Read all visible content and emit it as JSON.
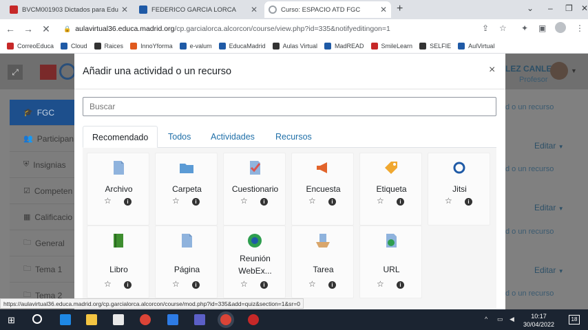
{
  "browser": {
    "tabs": [
      {
        "title": "BVCM001903 Dictados para Edu",
        "favicon_color": "#c62828"
      },
      {
        "title": "FEDERICO GARCIA LORCA",
        "favicon_color": "#1f5aa6"
      },
      {
        "title": "Curso: ESPACIO ATD FGC",
        "favicon_color": "#9aa0a6"
      }
    ],
    "new_tab": "+",
    "url_host": "aulavirtual36.educa.madrid.org",
    "url_path": "/cp.garcialorca.alcorcon/course/view.php?id=335&notifyeditingon=1",
    "bookmarks": [
      {
        "label": "CorreoEduca",
        "color": "#c62828"
      },
      {
        "label": "Cloud",
        "color": "#1f5aa6"
      },
      {
        "label": "Raices",
        "color": "#333333"
      },
      {
        "label": "InnoYforma",
        "color": "#e05a1e"
      },
      {
        "label": "e-valum",
        "color": "#1f5aa6"
      },
      {
        "label": "EducaMadrid",
        "color": "#1f5aa6"
      },
      {
        "label": "Aulas Virtual",
        "color": "#333333"
      },
      {
        "label": "MadREAD",
        "color": "#1f5aa6"
      },
      {
        "label": "SmileLearn",
        "color": "#c62828"
      },
      {
        "label": "SELFIE",
        "color": "#333333"
      },
      {
        "label": "AulVirtual",
        "color": "#1f5aa6"
      }
    ]
  },
  "moodle": {
    "user_name": "LEZ CANLE",
    "user_role": "Profesor",
    "nav": [
      {
        "label": "FGC",
        "icon": "graduation-cap-icon",
        "glyph": "🎓"
      },
      {
        "label": "Participan",
        "icon": "users-icon",
        "glyph": "👥"
      },
      {
        "label": "Insignias",
        "icon": "shield-icon",
        "glyph": "⛨"
      },
      {
        "label": "Competen",
        "icon": "check-square-icon",
        "glyph": "☑"
      },
      {
        "label": "Calificacio",
        "icon": "table-icon",
        "glyph": "▦"
      },
      {
        "label": "General",
        "icon": "folder-icon",
        "glyph": "🗀"
      },
      {
        "label": "Tema 1",
        "icon": "folder-icon",
        "glyph": "🗀"
      },
      {
        "label": "Tema 2",
        "icon": "folder-icon",
        "glyph": "🗀"
      }
    ],
    "right_links": {
      "add_resource": "d o un recurso",
      "edit": "Editar"
    }
  },
  "modal": {
    "title": "Añadir una actividad o un recurso",
    "close": "×",
    "search_placeholder": "Buscar",
    "tabs": [
      "Recomendado",
      "Todos",
      "Actividades",
      "Recursos"
    ],
    "activities": [
      {
        "name": "Archivo",
        "icon": "file-icon",
        "color": "#8fb3dd"
      },
      {
        "name": "Carpeta",
        "icon": "folder-icon",
        "color": "#5b9bd5"
      },
      {
        "name": "Cuestionario",
        "icon": "quiz-icon",
        "color": "#d9534f"
      },
      {
        "name": "Encuesta",
        "icon": "megaphone-icon",
        "color": "#e2642b"
      },
      {
        "name": "Etiqueta",
        "icon": "label-tag-icon",
        "color": "#f0a830"
      },
      {
        "name": "Jitsi",
        "icon": "jitsi-icon",
        "color": "#1f5aa6"
      },
      {
        "name": "Libro",
        "icon": "book-icon",
        "color": "#3e8e2f"
      },
      {
        "name": "Página",
        "icon": "page-icon",
        "color": "#8fb3dd"
      },
      {
        "name": "Reunión WebEx...",
        "line1": "Reunión",
        "line2": "WebEx...",
        "icon": "webex-icon",
        "color": "#2e9e4f"
      },
      {
        "name": "Tarea",
        "icon": "assignment-icon",
        "color": "#8fb3dd"
      },
      {
        "name": "URL",
        "icon": "url-globe-icon",
        "color": "#8fb3dd"
      }
    ],
    "star": "☆",
    "info": "i"
  },
  "status_url": "https://aulavirtual36.educa.madrid.org/cp.garcialorca.alcorcon/course/mod.php?id=335&add=quiz&section=1&sr=0",
  "taskbar": {
    "time": "10:17",
    "date": "30/04/2022",
    "notifications": "18"
  }
}
